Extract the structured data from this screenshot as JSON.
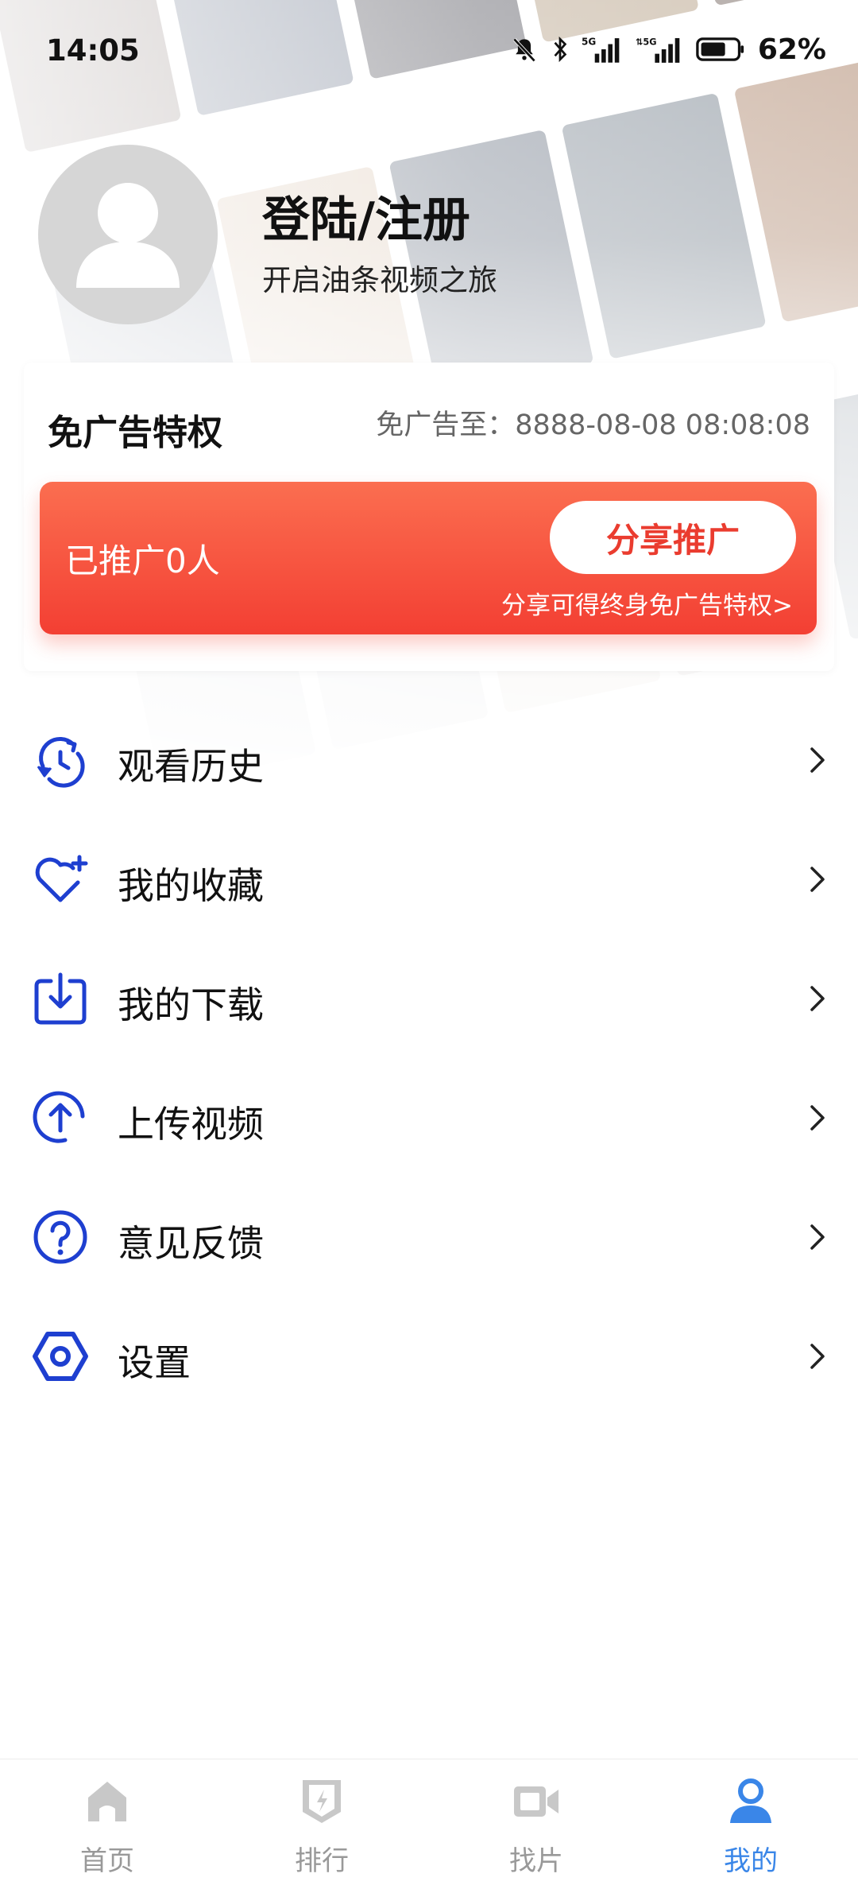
{
  "status_bar": {
    "time": "14:05",
    "battery": "62%",
    "icons": [
      "bell-muted-icon",
      "bluetooth-icon",
      "5g-signal-icon",
      "5g-signal-icon",
      "battery-icon"
    ]
  },
  "profile": {
    "title": "登陆/注册",
    "subtitle": "开启油条视频之旅"
  },
  "adfree": {
    "title": "免广告特权",
    "expiry": "免广告至：8888-08-08 08:08:08",
    "promo_count": "已推广0人",
    "share_button": "分享推广",
    "share_hint": "分享可得终身免广告特权>"
  },
  "menu": [
    {
      "label": "观看历史",
      "icon": "history-icon"
    },
    {
      "label": "我的收藏",
      "icon": "heart-plus-icon"
    },
    {
      "label": "我的下载",
      "icon": "download-icon"
    },
    {
      "label": "上传视频",
      "icon": "upload-icon"
    },
    {
      "label": "意见反馈",
      "icon": "question-icon"
    },
    {
      "label": "设置",
      "icon": "settings-icon"
    }
  ],
  "bottom_nav": [
    {
      "label": "首页",
      "icon": "home-icon",
      "active": false
    },
    {
      "label": "排行",
      "icon": "ranking-icon",
      "active": false
    },
    {
      "label": "找片",
      "icon": "video-camera-icon",
      "active": false
    },
    {
      "label": "我的",
      "icon": "user-icon",
      "active": true
    }
  ],
  "colors": {
    "accent_blue": "#1e3fd0",
    "promo_red": "#f33f33",
    "nav_active": "#3a86e8",
    "nav_inactive": "#c8c8c8"
  }
}
